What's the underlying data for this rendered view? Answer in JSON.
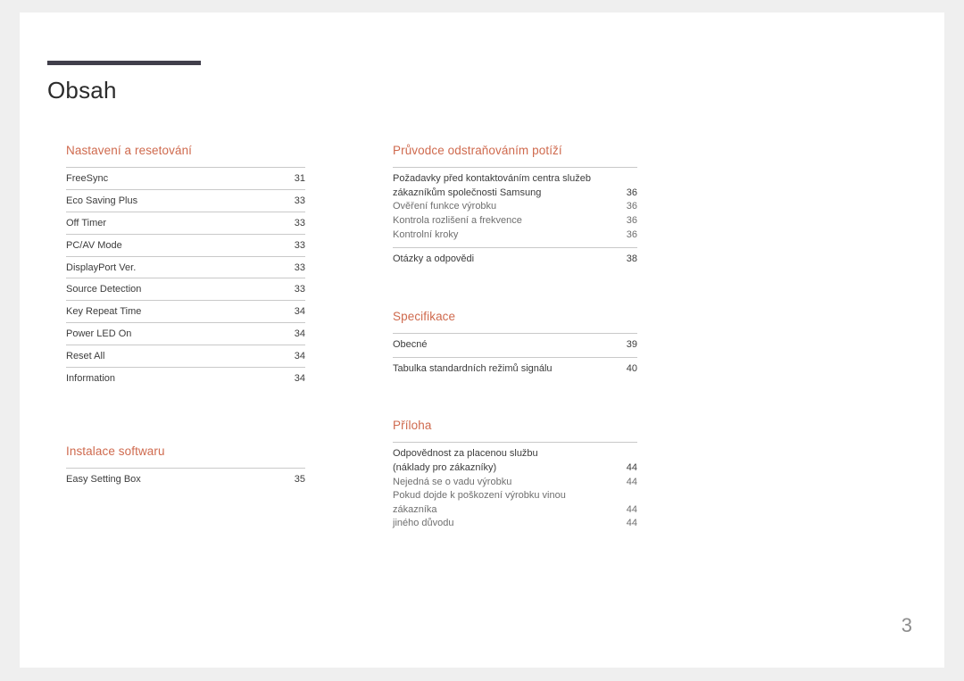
{
  "document": {
    "title": "Obsah",
    "folio": "3",
    "accent_color": "#cf6a4e",
    "rule_color": "#413f4b",
    "text_color": "#3c3c3c",
    "subtext_color": "#6f6f6f",
    "page_bg": "#ffffff",
    "canvas_bg": "#efefef"
  },
  "left_column": {
    "sections": [
      {
        "heading": "Nastavení a resetování",
        "entries": [
          {
            "label": "FreeSync",
            "page": "31"
          },
          {
            "label": "Eco Saving Plus",
            "page": "33"
          },
          {
            "label": "Off Timer",
            "page": "33"
          },
          {
            "label": "PC/AV Mode",
            "page": "33"
          },
          {
            "label": "DisplayPort Ver.",
            "page": "33"
          },
          {
            "label": "Source Detection",
            "page": "33"
          },
          {
            "label": "Key Repeat Time",
            "page": "34"
          },
          {
            "label": "Power LED On",
            "page": "34"
          },
          {
            "label": "Reset All",
            "page": "34"
          },
          {
            "label": "Information",
            "page": "34"
          }
        ]
      },
      {
        "heading": "Instalace softwaru",
        "entries": [
          {
            "label": "Easy Setting Box",
            "page": "35"
          }
        ]
      }
    ]
  },
  "right_column": {
    "sections": [
      {
        "heading": "Průvodce odstraňováním potíží",
        "groups": [
          {
            "lines": [
              {
                "label": "Požadavky před kontaktováním centra služeb",
                "page": "",
                "style": "main-cont"
              },
              {
                "label": "zákazníkům společnosti Samsung",
                "page": "36",
                "style": "main"
              },
              {
                "label": "Ověření funkce výrobku",
                "page": "36",
                "style": "sub"
              },
              {
                "label": "Kontrola rozlišení a frekvence",
                "page": "36",
                "style": "sub"
              },
              {
                "label": "Kontrolní kroky",
                "page": "36",
                "style": "sub"
              }
            ]
          },
          {
            "lines": [
              {
                "label": "Otázky a odpovědi",
                "page": "38",
                "style": "main"
              }
            ]
          }
        ]
      },
      {
        "heading": "Specifikace",
        "groups": [
          {
            "lines": [
              {
                "label": "Obecné",
                "page": "39",
                "style": "main"
              }
            ]
          },
          {
            "lines": [
              {
                "label": "Tabulka standardních režimů signálu",
                "page": "40",
                "style": "main"
              }
            ]
          }
        ]
      },
      {
        "heading": "Příloha",
        "groups": [
          {
            "lines": [
              {
                "label": "Odpovědnost za placenou službu",
                "page": "",
                "style": "main-cont"
              },
              {
                "label": "(náklady pro zákazníky)",
                "page": "44",
                "style": "main"
              },
              {
                "label": "Nejedná se o vadu výrobku",
                "page": "44",
                "style": "sub"
              },
              {
                "label": "Pokud dojde k poškození výrobku vinou",
                "page": "",
                "style": "sub-cont"
              },
              {
                "label": "zákazníka",
                "page": "44",
                "style": "sub"
              },
              {
                "label": "jiného důvodu",
                "page": "44",
                "style": "sub"
              }
            ]
          }
        ]
      }
    ]
  }
}
